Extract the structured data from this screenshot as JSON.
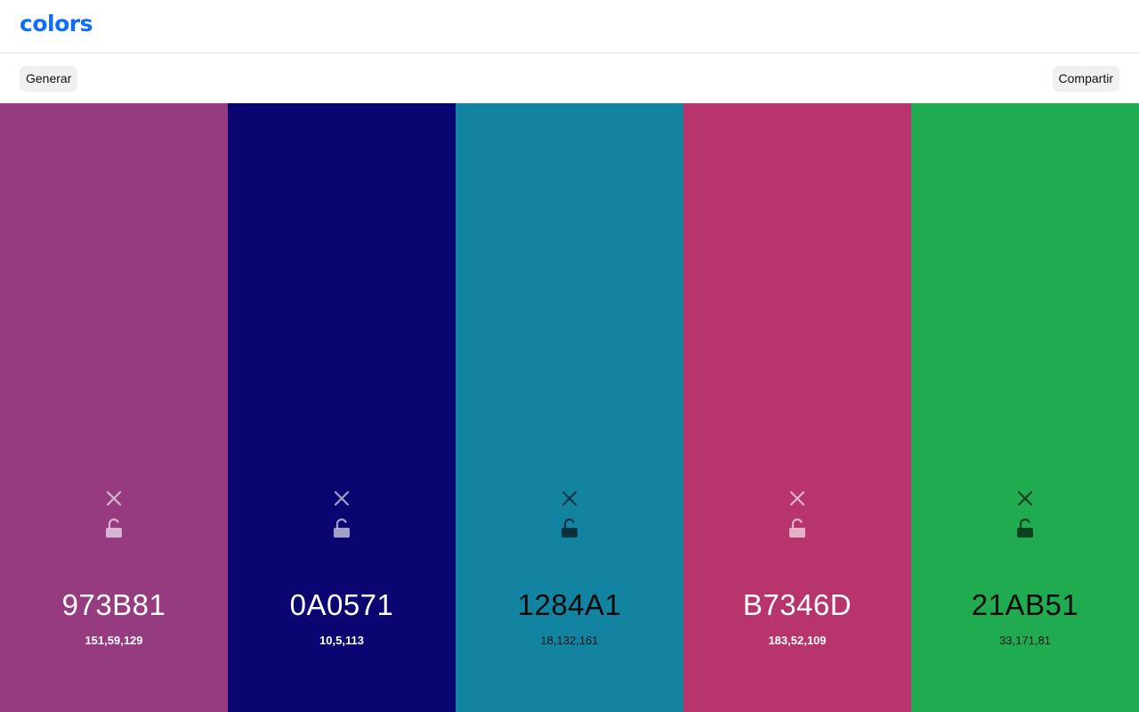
{
  "app": {
    "logo": "colors",
    "brand_color": "#0d6efd"
  },
  "toolbar": {
    "generate_label": "Generar",
    "share_label": "Compartir"
  },
  "palette": [
    {
      "hex": "973B81",
      "rgb": "151,59,129",
      "color": "#973B81",
      "text_tone": "light",
      "remove_icon": "close-icon",
      "lock_icon": "unlock-icon"
    },
    {
      "hex": "0A0571",
      "rgb": "10,5,113",
      "color": "#0A0571",
      "text_tone": "light",
      "remove_icon": "close-icon",
      "lock_icon": "unlock-icon"
    },
    {
      "hex": "1284A1",
      "rgb": "18,132,161",
      "color": "#1284A1",
      "text_tone": "dark",
      "remove_icon": "close-icon",
      "lock_icon": "unlock-icon"
    },
    {
      "hex": "B7346D",
      "rgb": "183,52,109",
      "color": "#B7346D",
      "text_tone": "light",
      "remove_icon": "close-icon",
      "lock_icon": "unlock-icon"
    },
    {
      "hex": "21AB51",
      "rgb": "33,171,81",
      "color": "#21AB51",
      "text_tone": "dark",
      "remove_icon": "close-icon",
      "lock_icon": "unlock-icon"
    }
  ]
}
